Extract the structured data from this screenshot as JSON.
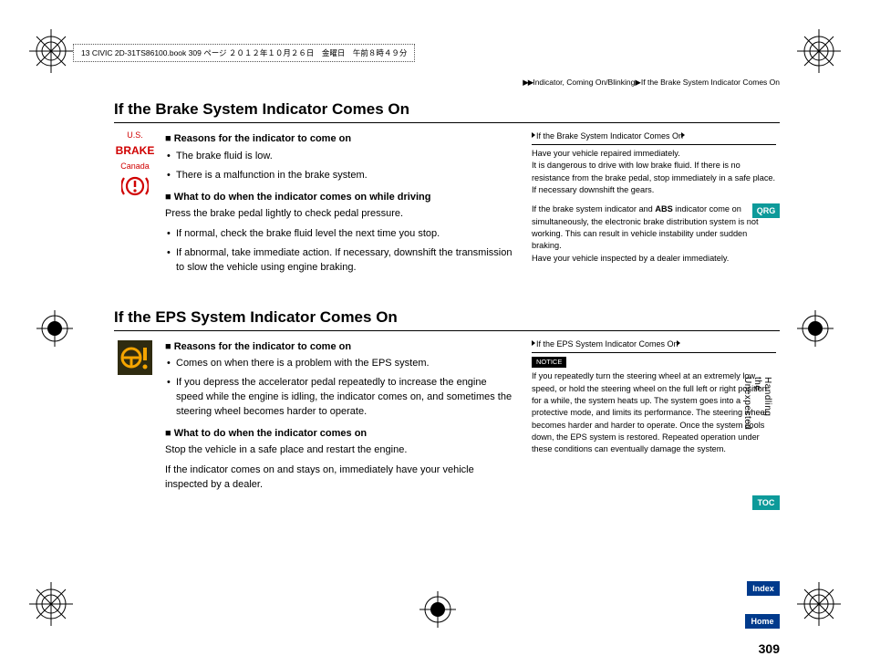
{
  "meta_line": "13 CIVIC 2D-31TS86100.book  309 ページ  ２０１２年１０月２６日　金曜日　午前８時４９分",
  "breadcrumb": {
    "a": "Indicator, Coming On/Blinking",
    "b": "If the Brake System Indicator Comes On"
  },
  "brake": {
    "title": "If the Brake System Indicator Comes On",
    "icon_us": "U.S.",
    "icon_brake": "BRAKE",
    "icon_ca": "Canada",
    "reasons_head": "Reasons for the indicator to come on",
    "reasons": [
      "The brake fluid is low.",
      "There is a malfunction in the brake system."
    ],
    "todo_head": "What to do when the indicator comes on while driving",
    "todo_intro": "Press the brake pedal lightly to check pedal pressure.",
    "todo": [
      "If normal, check the brake fluid level the next time you stop.",
      "If abnormal, take immediate action. If necessary, downshift the transmission to slow the vehicle using engine braking."
    ],
    "side_head": "If the Brake System Indicator Comes On",
    "side_p1": "Have your vehicle repaired immediately.\nIt is dangerous to drive with low brake fluid. If there is no resistance from the brake pedal, stop immediately in a safe place. If necessary downshift the gears.",
    "side_p2a": "If the brake system indicator and ",
    "side_p2b": "ABS",
    "side_p2c": " indicator come on simultaneously, the electronic brake distribution system is not working. This can result in vehicle instability under sudden braking.\nHave your vehicle inspected by a dealer immediately."
  },
  "eps": {
    "title": "If the EPS System Indicator Comes On",
    "reasons_head": "Reasons for the indicator to come on",
    "reasons": [
      "Comes on when there is a problem with the EPS system.",
      "If you depress the accelerator pedal repeatedly to increase the engine speed while the engine is idling, the indicator comes on, and sometimes the steering wheel becomes harder to operate."
    ],
    "todo_head": "What to do when the indicator comes on",
    "todo_p1": "Stop the vehicle in a safe place and restart the engine.",
    "todo_p2": "If the indicator comes on and stays on, immediately have your vehicle inspected by a dealer.",
    "side_head": "If the EPS System Indicator Comes On",
    "notice": "NOTICE",
    "side_p1": "If you repeatedly turn the steering wheel at an extremely low speed, or hold the steering wheel on the full left or right position for a while, the system heats up. The system goes into a protective mode, and limits its performance. The steering wheel becomes harder and harder to operate. Once the system cools down, the EPS system is restored. Repeated operation under these conditions can eventually damage the system."
  },
  "tabs": {
    "qrg": "QRG",
    "toc": "TOC",
    "index": "Index",
    "home": "Home"
  },
  "chapter": "Handling the Unexpected",
  "page_num": "309"
}
